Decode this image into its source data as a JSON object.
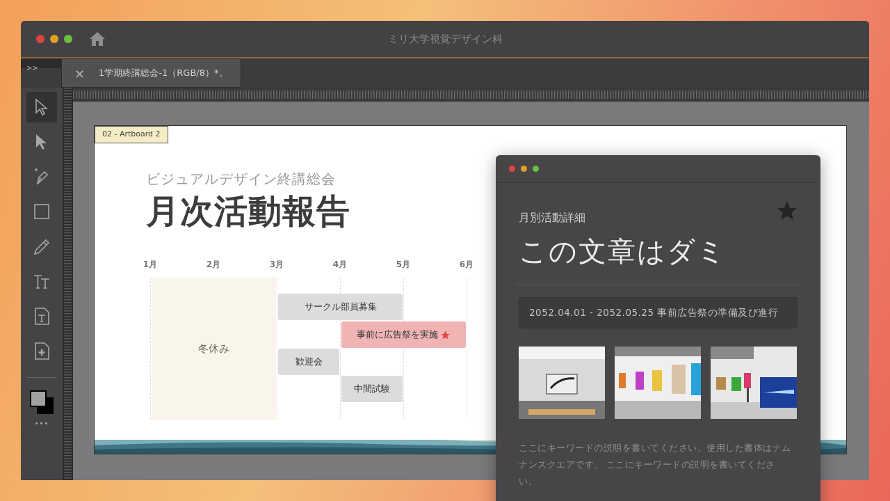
{
  "window": {
    "title": "ミリ大学視覚デザイン科"
  },
  "panel_toggle": ">>",
  "tabs": [
    {
      "label": "1学期終講総会-1（RGB/8）*。",
      "selected": true,
      "close": "×"
    }
  ],
  "tools": [
    {
      "selected": true
    },
    {
      "selected": false
    },
    {
      "selected": false
    },
    {
      "selected": false
    },
    {
      "selected": false
    },
    {
      "selected": false
    },
    {
      "selected": false
    },
    {
      "selected": false
    }
  ],
  "more": "•••",
  "artboard": {
    "label": "02 - Artboard 2",
    "subtitle": "ビジュアルデザイン終講総会",
    "title": "月次活動報告",
    "months": [
      "1月",
      "2月",
      "3月",
      "4月",
      "5月",
      "6月"
    ],
    "events": [
      {
        "label": "冬休み",
        "kind": "holiday"
      },
      {
        "label": "サークル部員募集",
        "kind": "normal"
      },
      {
        "label": "事前に広告祭を実施",
        "kind": "highlight",
        "starred": true
      },
      {
        "label": "歓迎会",
        "kind": "normal"
      },
      {
        "label": "中間試験",
        "kind": "normal"
      }
    ]
  },
  "detail": {
    "category": "月別活動詳細",
    "favorite": true,
    "title": "この文章はダミ",
    "period": "2052.04.01 - 2052.05.25 事前広告祭の準備及び進行",
    "description": "ここにキーワードの説明を書いてください。使用した書体はナムナンスクエアです。 ここにキーワードの説明を書いてください。"
  }
}
